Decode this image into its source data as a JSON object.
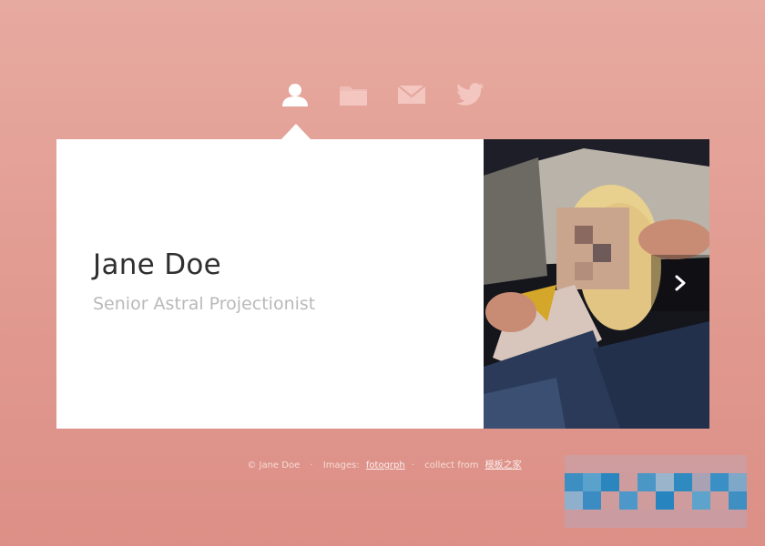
{
  "nav": {
    "items": [
      {
        "icon": "user-icon"
      },
      {
        "icon": "folder-icon"
      },
      {
        "icon": "mail-icon"
      },
      {
        "icon": "twitter-icon"
      }
    ],
    "active": 0
  },
  "profile": {
    "name": "Jane Doe",
    "title": "Senior Astral Projectionist"
  },
  "footer": {
    "copyright": "© Jane Doe",
    "sep1": "·",
    "images_label": "Images:",
    "images_link": "fotogrph",
    "sep2": "·",
    "collect_label": "collect from",
    "collect_link": "模板之家"
  },
  "colors": {
    "background": "#e19a90",
    "card": "#ffffff",
    "name_text": "#2f2f2f",
    "title_text": "#b9b9b9"
  }
}
